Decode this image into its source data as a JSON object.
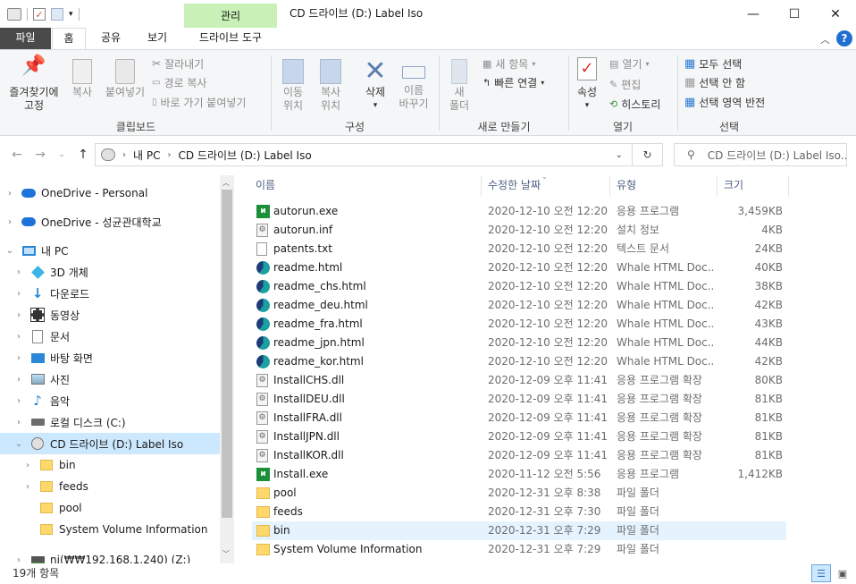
{
  "titlebar": {
    "manage_tab": "관리",
    "title": "CD 드라이브 (D:) Label Iso",
    "minimize": "—",
    "maximize": "☐",
    "close": "✕"
  },
  "ribbon_tabs": [
    "파일",
    "홈",
    "공유",
    "보기",
    "드라이브 도구"
  ],
  "ribbon": {
    "clipboard": {
      "pin": "즐겨찾기에\n고정",
      "copy": "복사",
      "paste": "붙여넣기",
      "cut": "잘라내기",
      "copy_path": "경로 복사",
      "paste_shortcut": "바로 가기 붙여넣기",
      "label": "클립보드"
    },
    "organize": {
      "move_to": "이동\n위치",
      "copy_to": "복사\n위치",
      "delete": "삭제",
      "rename": "이름\n바꾸기",
      "label": "구성"
    },
    "new": {
      "new_folder": "새\n폴더",
      "new_item": "새 항목",
      "easy_access": "빠른 연결",
      "label": "새로 만들기"
    },
    "open": {
      "properties": "속성",
      "open": "열기",
      "edit": "편집",
      "history": "히스토리",
      "label": "열기"
    },
    "select": {
      "select_all": "모두 선택",
      "select_none": "선택 안 함",
      "invert": "선택 영역 반전",
      "label": "선택"
    }
  },
  "address": {
    "crumbs": [
      "내 PC",
      "CD 드라이브 (D:) Label Iso"
    ],
    "search_placeholder": "CD 드라이브 (D:) Label Iso..."
  },
  "nav": [
    {
      "label": "OneDrive - Personal",
      "icon": "cloud-icon",
      "indent": 0,
      "chev": "›"
    },
    {
      "label": "OneDrive - 성균관대학교",
      "icon": "cloud-icon",
      "indent": 0,
      "chev": "›"
    },
    {
      "label": "내 PC",
      "icon": "computer-icon",
      "indent": 0,
      "chev": "⌄"
    },
    {
      "label": "3D 개체",
      "icon": "cube-icon",
      "indent": 1,
      "chev": "›"
    },
    {
      "label": "다운로드",
      "icon": "download-icon",
      "indent": 1,
      "chev": "›"
    },
    {
      "label": "동영상",
      "icon": "video-icon",
      "indent": 1,
      "chev": "›"
    },
    {
      "label": "문서",
      "icon": "document-icon",
      "indent": 1,
      "chev": "›"
    },
    {
      "label": "바탕 화면",
      "icon": "desktop-icon",
      "indent": 1,
      "chev": "›"
    },
    {
      "label": "사진",
      "icon": "picture-icon",
      "indent": 1,
      "chev": "›"
    },
    {
      "label": "음악",
      "icon": "music-icon",
      "indent": 1,
      "chev": "›"
    },
    {
      "label": "로컬 디스크 (C:)",
      "icon": "disk-icon",
      "indent": 1,
      "chev": "›"
    },
    {
      "label": "CD 드라이브 (D:) Label Iso",
      "icon": "cd-drive-icon",
      "indent": 1,
      "chev": "⌄",
      "selected": true
    },
    {
      "label": "bin",
      "icon": "folder-icon",
      "indent": 2,
      "chev": "›"
    },
    {
      "label": "feeds",
      "icon": "folder-icon",
      "indent": 2,
      "chev": "›"
    },
    {
      "label": "pool",
      "icon": "folder-icon",
      "indent": 2,
      "chev": ""
    },
    {
      "label": "System Volume Information",
      "icon": "folder-icon",
      "indent": 2,
      "chev": ""
    },
    {
      "label": "ni(₩₩192.168.1.240) (Z:)",
      "icon": "network-drive-icon",
      "indent": 1,
      "chev": "›"
    }
  ],
  "columns": {
    "name": "이름",
    "date": "수정한 날짜",
    "type": "유형",
    "size": "크기"
  },
  "files": [
    {
      "name": "autorun.exe",
      "date": "2020-12-10 오전 12:20",
      "type": "응용 프로그램",
      "size": "3,459KB",
      "icon": "exe-icon"
    },
    {
      "name": "autorun.inf",
      "date": "2020-12-10 오전 12:20",
      "type": "설치 정보",
      "size": "4KB",
      "icon": "settings-file-icon"
    },
    {
      "name": "patents.txt",
      "date": "2020-12-10 오전 12:20",
      "type": "텍스트 문서",
      "size": "24KB",
      "icon": "text-file-icon"
    },
    {
      "name": "readme.html",
      "date": "2020-12-10 오전 12:20",
      "type": "Whale HTML Doc...",
      "size": "40KB",
      "icon": "whale-icon"
    },
    {
      "name": "readme_chs.html",
      "date": "2020-12-10 오전 12:20",
      "type": "Whale HTML Doc...",
      "size": "38KB",
      "icon": "whale-icon"
    },
    {
      "name": "readme_deu.html",
      "date": "2020-12-10 오전 12:20",
      "type": "Whale HTML Doc...",
      "size": "42KB",
      "icon": "whale-icon"
    },
    {
      "name": "readme_fra.html",
      "date": "2020-12-10 오전 12:20",
      "type": "Whale HTML Doc...",
      "size": "43KB",
      "icon": "whale-icon"
    },
    {
      "name": "readme_jpn.html",
      "date": "2020-12-10 오전 12:20",
      "type": "Whale HTML Doc...",
      "size": "44KB",
      "icon": "whale-icon"
    },
    {
      "name": "readme_kor.html",
      "date": "2020-12-10 오전 12:20",
      "type": "Whale HTML Doc...",
      "size": "42KB",
      "icon": "whale-icon"
    },
    {
      "name": "InstallCHS.dll",
      "date": "2020-12-09 오후 11:41",
      "type": "응용 프로그램 확장",
      "size": "80KB",
      "icon": "dll-icon"
    },
    {
      "name": "InstallDEU.dll",
      "date": "2020-12-09 오후 11:41",
      "type": "응용 프로그램 확장",
      "size": "81KB",
      "icon": "dll-icon"
    },
    {
      "name": "InstallFRA.dll",
      "date": "2020-12-09 오후 11:41",
      "type": "응용 프로그램 확장",
      "size": "81KB",
      "icon": "dll-icon"
    },
    {
      "name": "InstallJPN.dll",
      "date": "2020-12-09 오후 11:41",
      "type": "응용 프로그램 확장",
      "size": "81KB",
      "icon": "dll-icon"
    },
    {
      "name": "InstallKOR.dll",
      "date": "2020-12-09 오후 11:41",
      "type": "응용 프로그램 확장",
      "size": "81KB",
      "icon": "dll-icon"
    },
    {
      "name": "Install.exe",
      "date": "2020-11-12 오전 5:56",
      "type": "응용 프로그램",
      "size": "1,412KB",
      "icon": "exe-icon"
    },
    {
      "name": "pool",
      "date": "2020-12-31 오후 8:38",
      "type": "파일 폴더",
      "size": "",
      "icon": "folder-icon"
    },
    {
      "name": "feeds",
      "date": "2020-12-31 오후 7:30",
      "type": "파일 폴더",
      "size": "",
      "icon": "folder-icon"
    },
    {
      "name": "bin",
      "date": "2020-12-31 오후 7:29",
      "type": "파일 폴더",
      "size": "",
      "icon": "folder-icon",
      "hover": true
    },
    {
      "name": "System Volume Information",
      "date": "2020-12-31 오후 7:29",
      "type": "파일 폴더",
      "size": "",
      "icon": "folder-icon"
    }
  ],
  "status": {
    "item_count": "19개 항목"
  },
  "colors": {
    "accent": "#cce8ff",
    "manage": "#c8f0b7",
    "folder": "#ffd86b",
    "whale": "#1aa0a0"
  }
}
